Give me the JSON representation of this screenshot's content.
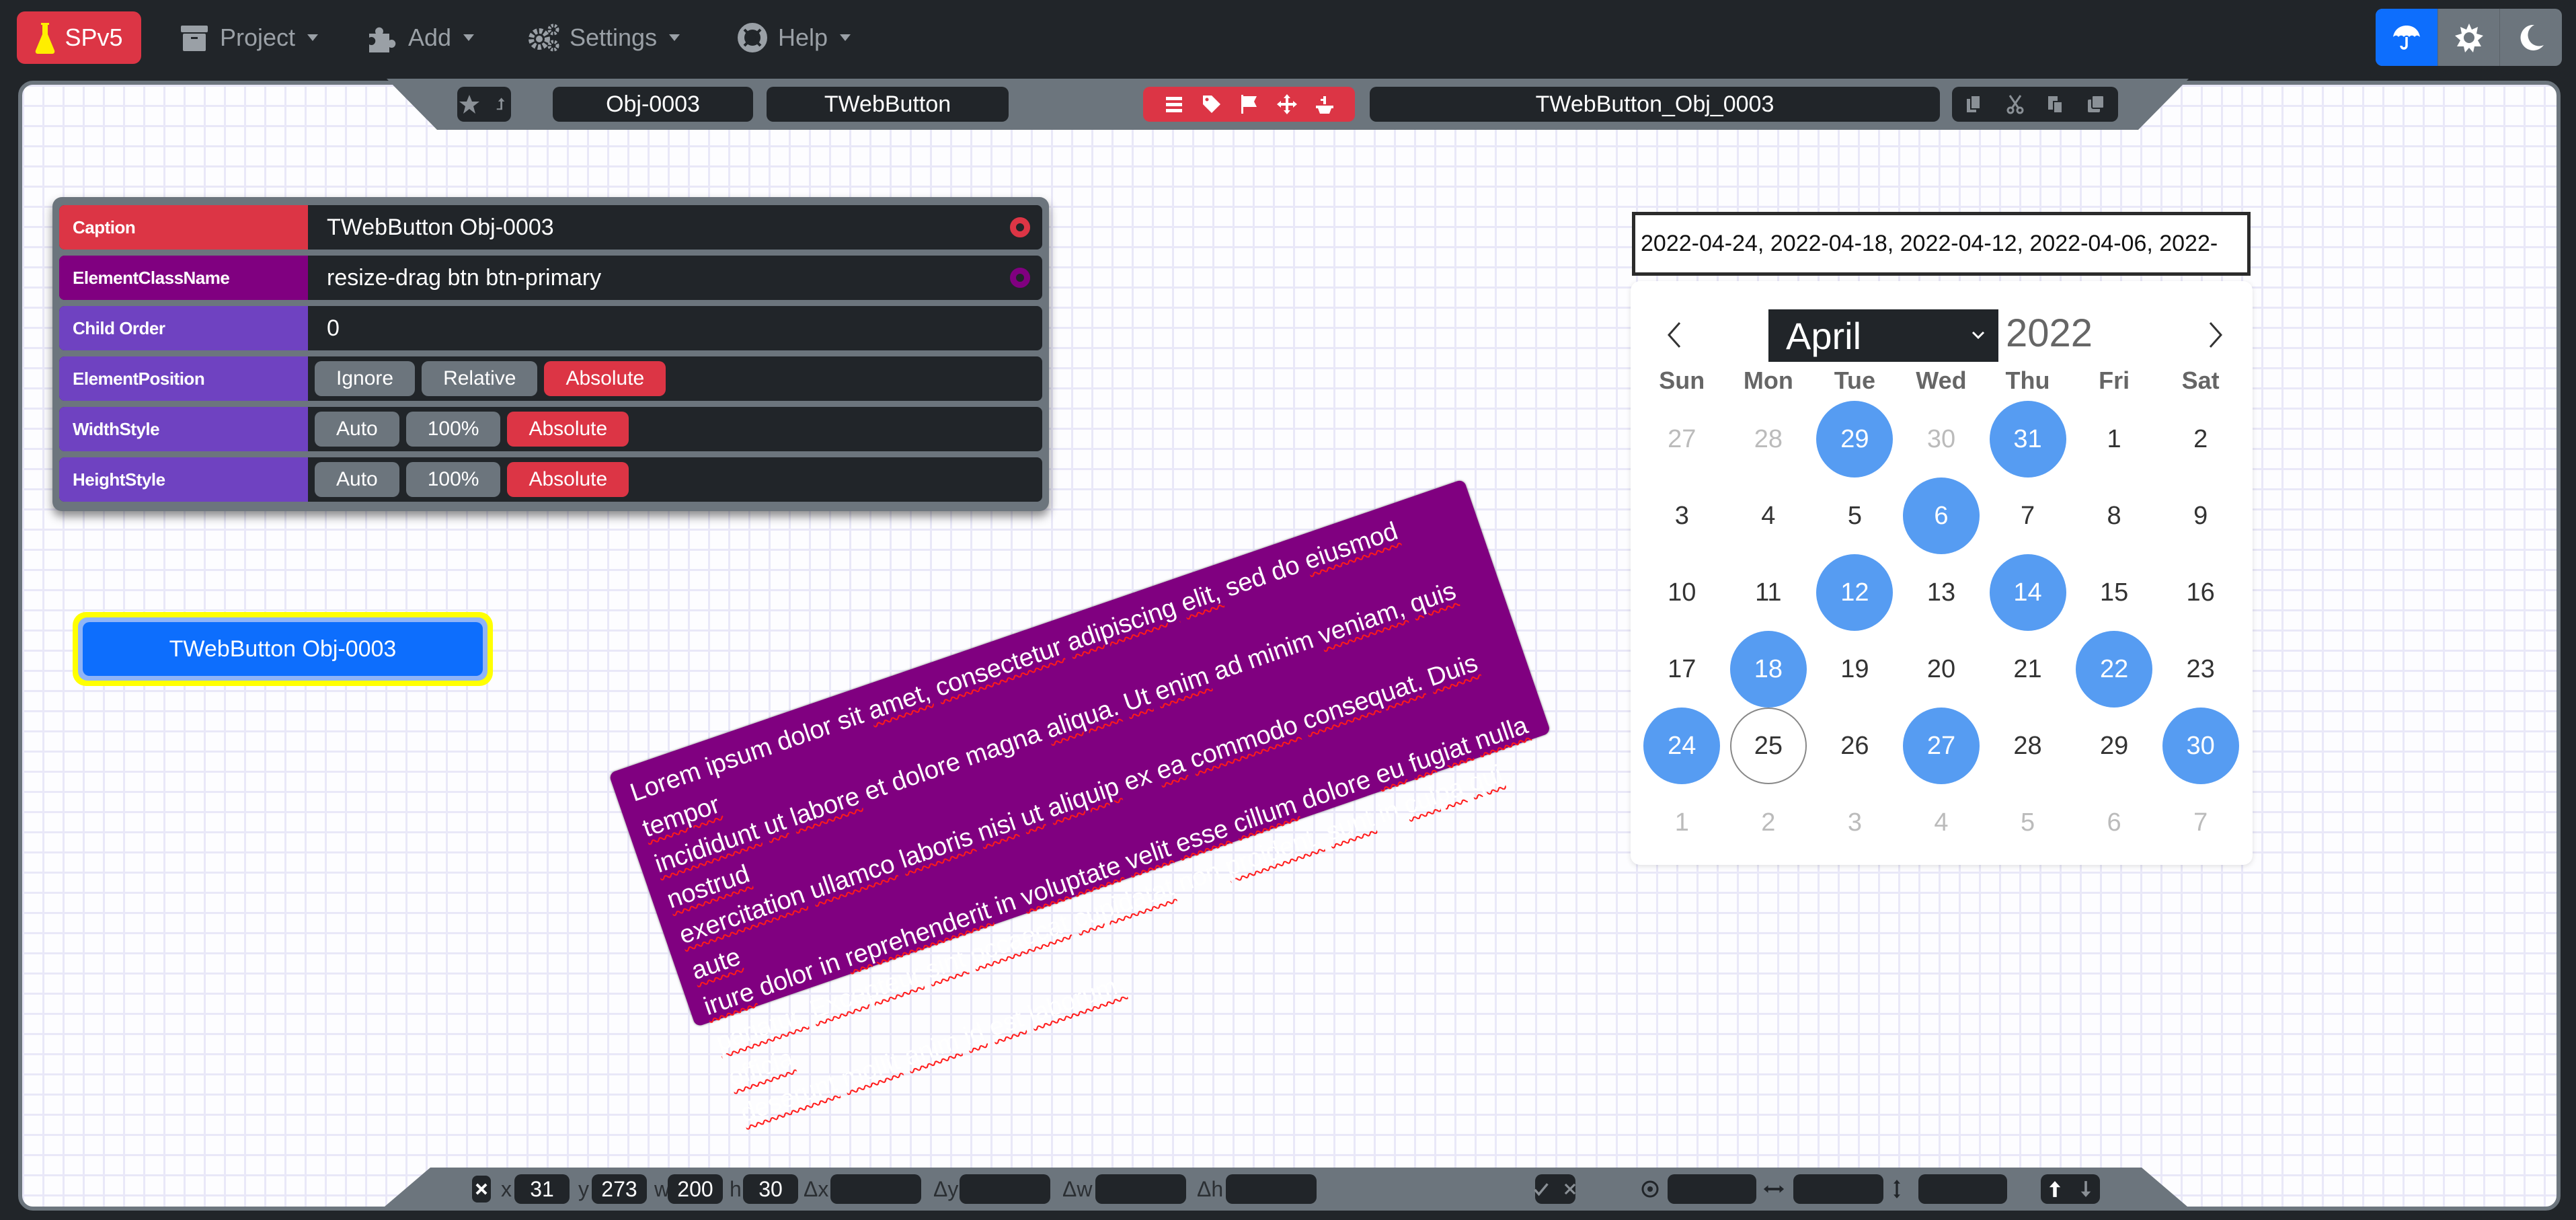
{
  "nav": {
    "brand": {
      "label": "SPv5",
      "icon": "flask-icon",
      "color": "#dc3545"
    },
    "menus": [
      {
        "label": "Project",
        "icon": "archive-icon"
      },
      {
        "label": "Add",
        "icon": "puzzle-icon"
      },
      {
        "label": "Settings",
        "icon": "gears-icon"
      },
      {
        "label": "Help",
        "icon": "life-ring-icon"
      }
    ],
    "theme_buttons": [
      {
        "icon": "umbrella-icon",
        "active": true
      },
      {
        "icon": "sun-icon",
        "active": false
      },
      {
        "icon": "moon-icon",
        "active": false
      }
    ]
  },
  "top_toolbar": {
    "icons_left": [
      "star-icon",
      "level-up-icon"
    ],
    "object_id": "Obj-0003",
    "object_type": "TWebButton",
    "action_icons": [
      "list-icon",
      "tag-icon",
      "flag-icon",
      "move-icon",
      "paste-icon"
    ],
    "object_name": "TWebButton_Obj_0003",
    "clipboard_icons": [
      "copy-icon",
      "cut-icon",
      "paste-icon",
      "clone-icon"
    ]
  },
  "properties": [
    {
      "label": "Caption",
      "value": "TWebButton Obj-0003",
      "label_color": "#dc3545"
    },
    {
      "label": "ElementClassName",
      "value": "resize-drag btn btn-primary",
      "label_color": "#800080"
    },
    {
      "label": "Child Order",
      "value": "0",
      "label_color": "#6f42c1"
    },
    {
      "label": "ElementPosition",
      "options": [
        "Ignore",
        "Relative",
        "Absolute"
      ],
      "selected": "Absolute",
      "label_color": "#6f42c1"
    },
    {
      "label": "WidthStyle",
      "options": [
        "Auto",
        "100%",
        "Absolute"
      ],
      "selected": "Absolute",
      "label_color": "#6f42c1"
    },
    {
      "label": "HeightStyle",
      "options": [
        "Auto",
        "100%",
        "Absolute"
      ],
      "selected": "Absolute",
      "label_color": "#6f42c1"
    }
  ],
  "canvas": {
    "selected_button": {
      "caption": "TWebButton Obj-0003"
    },
    "memo_text": "Lorem ipsum dolor sit amet, consectetur adipiscing elit, sed do eiusmod tempor incididunt ut labore et dolore magna aliqua. Ut enim ad minim veniam, quis nostrud exercitation ullamco laboris nisi ut aliquip ex ea commodo consequat. Duis aute irure dolor in reprehenderit in voluptate velit esse cillum dolore eu fugiat nulla pariatur. Excepteur sint occaecat cupidatat non proident, sunt in culpa qui officia deserunt mollit anim id est laborum.",
    "memo_lines": [
      "Lorem ipsum dolor sit amet, consectetur adipiscing elit, sed do eiusmod tempor",
      "incididunt ut labore et dolore magna aliqua. Ut enim ad minim veniam, quis nostrud",
      "exercitation ullamco laboris nisi ut aliquip ex ea commodo consequat. Duis aute",
      "irure dolor in reprehenderit in voluptate velit esse cillum dolore eu fugiat nulla",
      "pariatur. Excepteur sint occaecat cupidatat non proident, sunt in culpa qui officia",
      "deserunt mollit anim id est laborum."
    ],
    "memo_color": "#800080"
  },
  "datepicker": {
    "input_value": "2022-04-24, 2022-04-18, 2022-04-12, 2022-04-06, 2022-",
    "month": "April",
    "year": "2022",
    "weekdays": [
      "Sun",
      "Mon",
      "Tue",
      "Wed",
      "Thu",
      "Fri",
      "Sat"
    ],
    "weeks": [
      [
        {
          "d": "27",
          "muted": true
        },
        {
          "d": "28",
          "muted": true
        },
        {
          "d": "29",
          "sel": true
        },
        {
          "d": "30",
          "muted": true
        },
        {
          "d": "31",
          "sel": true
        },
        {
          "d": "1"
        },
        {
          "d": "2"
        }
      ],
      [
        {
          "d": "3"
        },
        {
          "d": "4"
        },
        {
          "d": "5"
        },
        {
          "d": "6",
          "sel": true
        },
        {
          "d": "7"
        },
        {
          "d": "8"
        },
        {
          "d": "9"
        }
      ],
      [
        {
          "d": "10"
        },
        {
          "d": "11"
        },
        {
          "d": "12",
          "sel": true
        },
        {
          "d": "13"
        },
        {
          "d": "14",
          "sel": true
        },
        {
          "d": "15"
        },
        {
          "d": "16"
        }
      ],
      [
        {
          "d": "17"
        },
        {
          "d": "18",
          "sel": true
        },
        {
          "d": "19"
        },
        {
          "d": "20"
        },
        {
          "d": "21"
        },
        {
          "d": "22",
          "sel": true
        },
        {
          "d": "23"
        }
      ],
      [
        {
          "d": "24",
          "sel": true
        },
        {
          "d": "25",
          "today": true
        },
        {
          "d": "26"
        },
        {
          "d": "27",
          "sel": true
        },
        {
          "d": "28"
        },
        {
          "d": "29"
        },
        {
          "d": "30",
          "sel": true
        }
      ],
      [
        {
          "d": "1",
          "muted": true
        },
        {
          "d": "2",
          "muted": true
        },
        {
          "d": "3",
          "muted": true
        },
        {
          "d": "4",
          "muted": true
        },
        {
          "d": "5",
          "muted": true
        },
        {
          "d": "6",
          "muted": true
        },
        {
          "d": "7",
          "muted": true
        }
      ]
    ],
    "selected_color": "#569cf2"
  },
  "bottom_toolbar": {
    "fields": [
      {
        "label": "x",
        "value": "31"
      },
      {
        "label": "y",
        "value": "273"
      },
      {
        "label": "w",
        "value": "200"
      },
      {
        "label": "h",
        "value": "30"
      },
      {
        "label": "Δx",
        "value": ""
      },
      {
        "label": "Δy",
        "value": ""
      },
      {
        "label": "Δw",
        "value": ""
      },
      {
        "label": "Δh",
        "value": ""
      }
    ],
    "close_icon": "close-icon",
    "confirm_icons": [
      "check-icon",
      "cancel-icon"
    ],
    "extra_fields": [
      {
        "icon": "target-icon",
        "value": ""
      },
      {
        "icon": "horizontal-resize-icon",
        "value": ""
      },
      {
        "icon": "vertical-resize-icon",
        "value": ""
      }
    ],
    "order_icons": [
      "arrow-up-icon",
      "arrow-down-icon"
    ]
  }
}
